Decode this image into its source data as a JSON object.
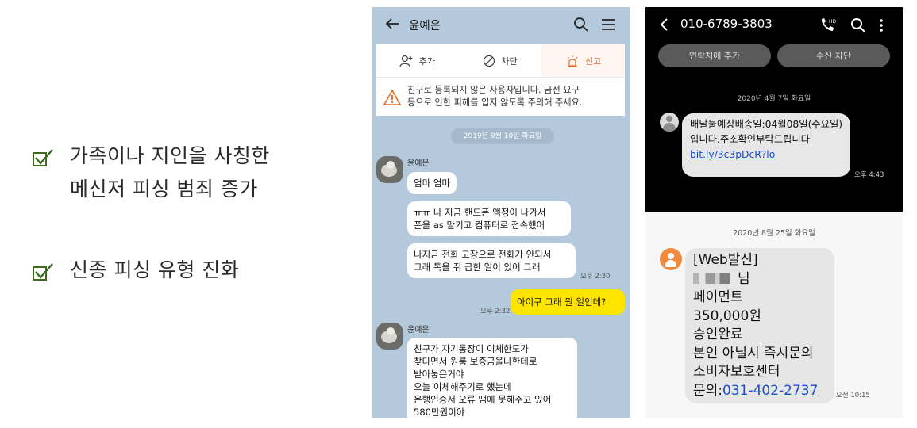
{
  "bullets": [
    {
      "line1": "가족이나 지인을 사칭한",
      "line2": "메신저 피싱 범죄 증가"
    },
    {
      "line1": "신종 피싱 유형 진화"
    }
  ],
  "chat": {
    "title": "윤예은",
    "actions": {
      "add": "추가",
      "block": "차단",
      "report": "신고"
    },
    "warning": "친구로 등록되지 않은 사용자입니다. 금전 요구\n등으로 인한 피해를 입지 않도록 주의해 주세요.",
    "date": "2019년 9월 10일 화요일",
    "sender": "윤예은",
    "messages": [
      "엄마 엄마",
      "ㅠㅠ 나 지금 핸드폰 액정이 나가서\n폰을 as 맡기고 컴퓨터로 접속했어",
      "나지금 전화 고장으로 전화가 안되서\n그래 톡을 줘 급한 일이 있어 그래",
      "아이구 그래 뭔 일인데?",
      "친구가 자기통장이 이체한도가\n찾다면서 원룸 보증금을나한테로\n받아놓은거야\n오늘 이체해주기로 했는데\n은행인증서 오류 땜에 못해주고 있어\n580만원이야"
    ],
    "times": {
      "t1": "오후 2:30",
      "t2": "오후 2:32"
    }
  },
  "sms_dark": {
    "number": "010-6789-3803",
    "btn_add": "연락처에 추가",
    "btn_block": "수신 차단",
    "date": "2020년 4월 7일 화요일",
    "message_text": "배달물예상배송일:04월08일(수요일)입니다.주소확인부탁드립니다 ",
    "link": "bit.ly/3c3pDcR?lo",
    "time": "오후 4:43"
  },
  "sms_light": {
    "date": "2020년 8월 25일 화요일",
    "lines": {
      "l1": "[Web발신]",
      "l2_suffix": "님",
      "l3": "페이먼트",
      "l4": "350,000원",
      "l5": "승인완료",
      "l6": "본인 아닐시 즉시문의",
      "l7": "소비자보호센터",
      "l8_prefix": "문의:",
      "phone_link": "031-402-2737"
    },
    "time": "오전 10:15"
  },
  "colors": {
    "chat_bg": "#b4c9dc",
    "my_bubble": "#fee500",
    "check_green": "#3d6b1f",
    "link_blue": "#1b4fc9",
    "report_orange": "#e06a2a"
  }
}
